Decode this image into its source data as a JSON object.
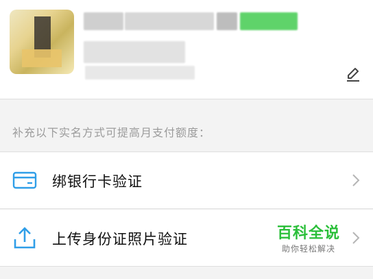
{
  "section_tip": "补充以下实名方式可提高月支付额度：",
  "rows": [
    {
      "label": "绑银行卡验证",
      "icon": "bank-card-icon"
    },
    {
      "label": "上传身份证照片验证",
      "icon": "upload-icon"
    }
  ],
  "watermark": {
    "main": "百科全说",
    "sub": "助你轻松解决"
  },
  "colors": {
    "accent": "#2f9ee8",
    "watermark_green": "#2bbf3a",
    "background": "#f3f3f3"
  }
}
